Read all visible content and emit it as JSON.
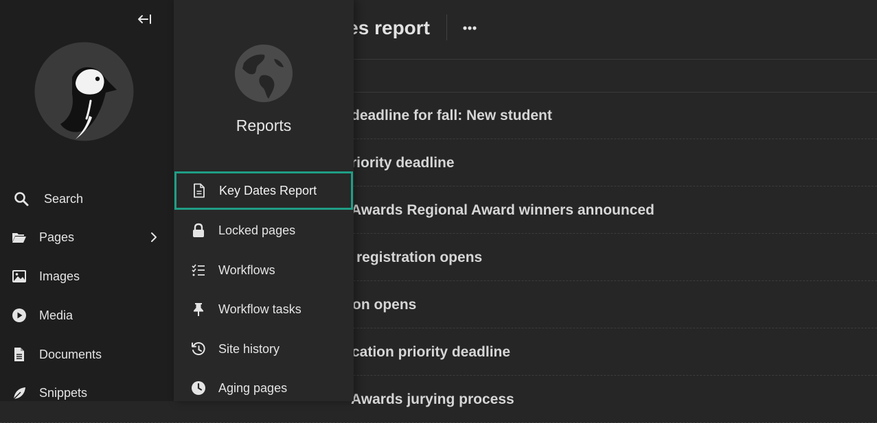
{
  "main": {
    "title": "es report",
    "more_label": "•••",
    "rows": [
      {
        "title": "deadline for fall: New student"
      },
      {
        "title": "riority deadline"
      },
      {
        "title": "Awards Regional Award winners announced"
      },
      {
        "title": "registration opens"
      },
      {
        "title": "on opens"
      },
      {
        "title": "cation priority deadline"
      },
      {
        "title": "Awards jurying process"
      }
    ]
  },
  "sidebar": {
    "collapse_label": "←|",
    "items": [
      {
        "label": "Search",
        "icon": "search-icon"
      },
      {
        "label": "Pages",
        "icon": "folder-open-icon",
        "has_submenu": true
      },
      {
        "label": "Images",
        "icon": "image-icon"
      },
      {
        "label": "Media",
        "icon": "media-play-icon"
      },
      {
        "label": "Documents",
        "icon": "document-icon"
      },
      {
        "label": "Snippets",
        "icon": "snippet-leaf-icon"
      }
    ]
  },
  "reports_panel": {
    "title": "Reports",
    "icon": "globe-icon",
    "items": [
      {
        "label": "Key Dates Report",
        "icon": "document-lines-icon",
        "active": true
      },
      {
        "label": "Locked pages",
        "icon": "lock-icon"
      },
      {
        "label": "Workflows",
        "icon": "tasks-icon"
      },
      {
        "label": "Workflow tasks",
        "icon": "thumbtack-icon"
      },
      {
        "label": "Site history",
        "icon": "history-icon"
      },
      {
        "label": "Aging pages",
        "icon": "clock-icon"
      }
    ]
  },
  "colors": {
    "sidebar_bg": "#1e1e1e",
    "panel_bg": "#282828",
    "main_bg": "#262626",
    "active_outline": "#1f9e86"
  }
}
